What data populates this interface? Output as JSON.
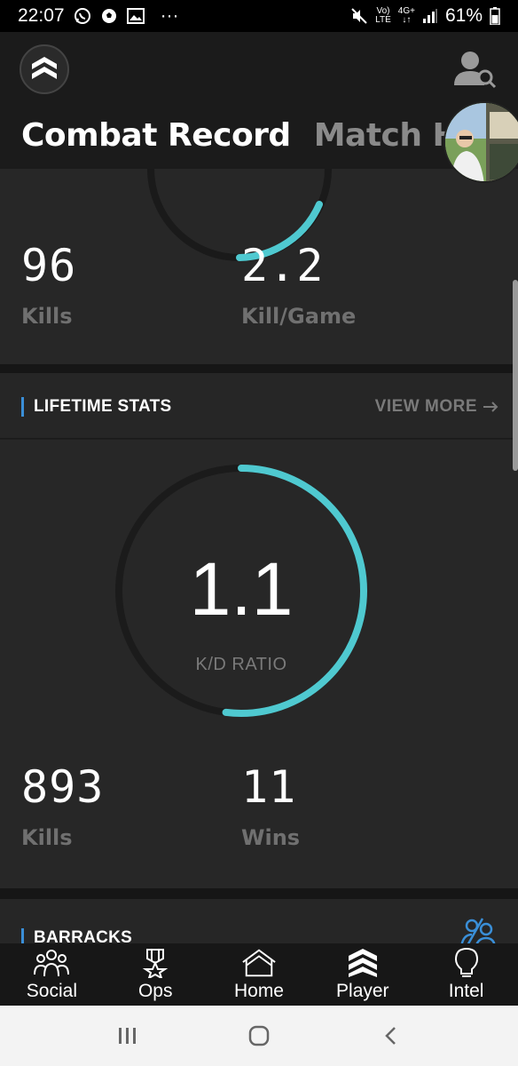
{
  "status_bar": {
    "time": "22:07",
    "overflow": "···",
    "network_top": "Vo)",
    "network_bottom": "LTE",
    "data_top": "4G+",
    "data_bottom": "↓↑",
    "battery": "61%"
  },
  "header": {
    "tabs": [
      {
        "label": "Combat Record",
        "active": true
      },
      {
        "label": "Match High",
        "active": false
      }
    ]
  },
  "recent": {
    "stats": [
      {
        "value": "96",
        "label": "Kills"
      },
      {
        "value": "2.2",
        "label": "Kill/Game"
      }
    ]
  },
  "lifetime": {
    "title": "LIFETIME STATS",
    "view_more": "VIEW MORE",
    "kd_value": "1.1",
    "kd_label": "K/D RATIO",
    "kd_fill_fraction": 0.52,
    "stats": [
      {
        "value": "893",
        "label": "Kills"
      },
      {
        "value": "11",
        "label": "Wins"
      }
    ]
  },
  "barracks": {
    "title": "BARRACKS"
  },
  "bottom_nav": {
    "items": [
      {
        "label": "Social",
        "icon": "social-icon"
      },
      {
        "label": "Ops",
        "icon": "ops-icon"
      },
      {
        "label": "Home",
        "icon": "home-icon"
      },
      {
        "label": "Player",
        "icon": "player-icon"
      },
      {
        "label": "Intel",
        "icon": "intel-icon"
      }
    ]
  },
  "colors": {
    "accent": "#4fc9d0",
    "section_marker": "#3a8fd8",
    "background": "#1e1e1e",
    "card": "#272727"
  }
}
